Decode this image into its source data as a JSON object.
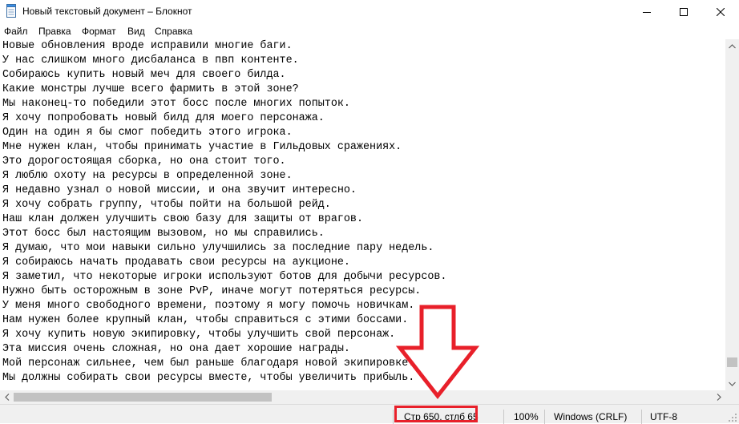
{
  "window": {
    "title": "Новый текстовый документ – Блокнот",
    "icons": {
      "app": "notepad-icon",
      "minimize": "minimize-icon",
      "maximize": "maximize-icon",
      "close": "close-icon"
    }
  },
  "menu": {
    "items": [
      "Файл",
      "Правка",
      "Формат",
      "Вид",
      "Справка"
    ]
  },
  "editor": {
    "lines": [
      "Новые обновления вроде исправили многие баги.",
      "У нас слишком много дисбаланса в пвп контенте.",
      "Собираюсь купить новый меч для своего билда.",
      "Какие монстры лучше всего фармить в этой зоне?",
      "Мы наконец-то победили этот босс после многих попыток.",
      "Я хочу попробовать новый билд для моего персонажа.",
      "Один на один я бы смог победить этого игрока.",
      "Мне нужен клан, чтобы принимать участие в Гильдовых сражениях.",
      "Это дорогостоящая сборка, но она стоит того.",
      "Я люблю охоту на ресурсы в определенной зоне.",
      "Я недавно узнал о новой миссии, и она звучит интересно.",
      "Я хочу собрать группу, чтобы пойти на большой рейд.",
      "Наш клан должен улучшить свою базу для защиты от врагов.",
      "Этот босс был настоящим вызовом, но мы справились.",
      "Я думаю, что мои навыки сильно улучшились за последние пару недель.",
      "Я собираюсь начать продавать свои ресурсы на аукционе.",
      "Я заметил, что некоторые игроки используют ботов для добычи ресурсов.",
      "Нужно быть осторожным в зоне PvP, иначе могут потеряться ресурсы.",
      "У меня много свободного времени, поэтому я могу помочь новичкам.",
      "Нам нужен более крупный клан, чтобы справиться с этими боссами.",
      "Я хочу купить новую экипировку, чтобы улучшить свой персонаж.",
      "Эта миссия очень сложная, но она дает хорошие награды.",
      "Мой персонаж сильнее, чем был раньше благодаря новой экипировке.",
      "Мы должны собирать свои ресурсы вместе, чтобы увеличить прибыль."
    ]
  },
  "scrollbars": {
    "vertical_position": 0.97,
    "horizontal_thumb_fraction": 0.37
  },
  "status": {
    "position": "Стр 650, стлб 65",
    "zoom": "100%",
    "line_endings": "Windows (CRLF)",
    "encoding": "UTF-8"
  },
  "annotation": {
    "color": "#e8202a",
    "arrow_icon": "down-arrow-icon"
  }
}
